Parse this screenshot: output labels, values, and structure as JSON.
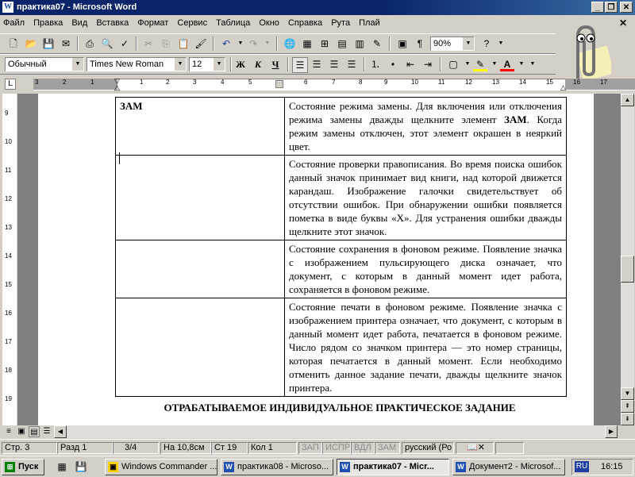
{
  "window": {
    "title": "практика07 - Microsoft Word",
    "app_letter": "W"
  },
  "menu": [
    "Файл",
    "Правка",
    "Вид",
    "Вставка",
    "Формат",
    "Сервис",
    "Таблица",
    "Окно",
    "Справка",
    "Рута",
    "Плай"
  ],
  "toolbar_standard": {
    "zoom": "90%"
  },
  "toolbar_format": {
    "style": "Обычный",
    "font": "Times New Roman",
    "size": "12",
    "bold": "Ж",
    "italic": "К",
    "underline": "Ч",
    "font_color_letter": "A"
  },
  "ruler": {
    "ticks": [
      "3",
      "2",
      "1",
      "1",
      "2",
      "3",
      "4",
      "5",
      "6",
      "7",
      "8",
      "9",
      "10",
      "11",
      "12",
      "13",
      "14",
      "15",
      "16",
      "17"
    ]
  },
  "vruler": {
    "ticks": [
      "9",
      "10",
      "11",
      "12",
      "13",
      "14",
      "15",
      "16",
      "17",
      "18",
      "19"
    ]
  },
  "table": {
    "rows": [
      {
        "left": "ЗАМ",
        "right_parts": [
          "Состояние режима замены. Для включения или отключения режима замены дважды щелкните элемент ",
          "ЗАМ",
          ". Когда режим замены отключен, этот элемент окрашен в неяркий цвет."
        ]
      },
      {
        "left": "",
        "right": "Состояние проверки правописания. Во время поиска ошибок данный значок принимает вид книги, над которой движется карандаш. Изображение галочки свидетельствует об отсутствии ошибок. При обнаружении ошибки появляется пометка в виде буквы «X». Для устранения ошибки дважды щелкните этот значок."
      },
      {
        "left": "",
        "right": "Состояние сохранения в фоновом режиме. Появление значка с изображением пульсирующего диска означает, что документ, с которым в данный момент идет работа, сохраняется в фоновом режиме."
      },
      {
        "left": "",
        "right": "Состояние печати в фоновом режиме. Появление значка с изображением принтера означает, что документ, с которым в данный момент идет работа, печатается в фоновом режиме. Число рядом со значком принтера — это номер страницы, которая печатается в данный момент. Если необходимо отменить данное задание печати, дважды щелкните значок принтера."
      }
    ]
  },
  "heading": "ОТРАБАТЫВАЕМОЕ  ИНДИВИДУАЛЬНОЕ ПРАКТИЧЕСКОЕ ЗАДАНИЕ",
  "status": {
    "page": "Стр.  3",
    "section": "Разд  1",
    "pages": "3/4",
    "position": "На 10,8см",
    "line": "Ст  19",
    "col": "Кол  1",
    "zap": "ЗАП",
    "ispr": "ИСПР",
    "vdl": "ВДЛ",
    "zam": "ЗАМ",
    "language": "русский (Ро"
  },
  "taskbar": {
    "start": "Пуск",
    "items": [
      "Windows Commander ...",
      "практика08 - Microso...",
      "практика07 - Micr...",
      "Документ2 - Microsof..."
    ],
    "lang": "RU",
    "time": "16:15"
  }
}
